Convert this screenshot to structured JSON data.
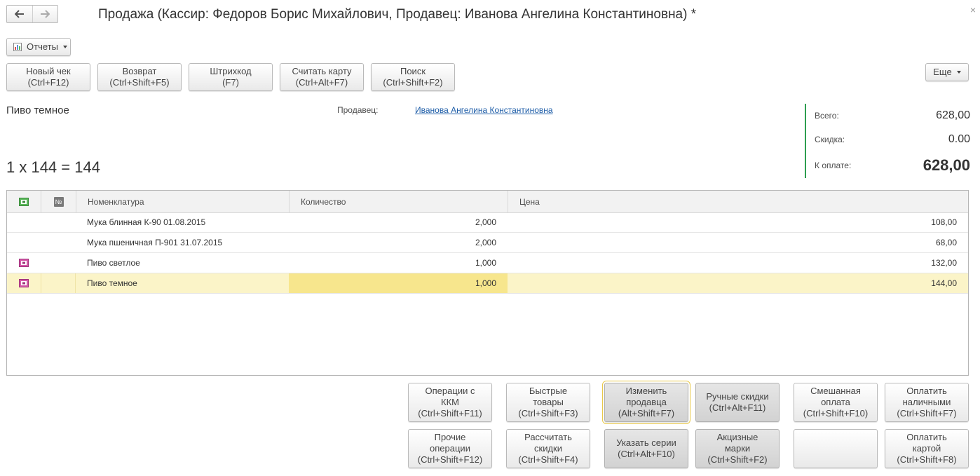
{
  "window": {
    "title": "Продажа (Кассир: Федоров Борис Михайлович, Продавец: Иванова Ангелина Константиновна) *"
  },
  "toolbar": {
    "reports_label": "Отчеты",
    "more_label": "Еще",
    "buttons": [
      {
        "line1": "Новый чек",
        "line2": "(Ctrl+F12)"
      },
      {
        "line1": "Возврат",
        "line2": "(Ctrl+Shift+F5)"
      },
      {
        "line1": "Штрихкод",
        "line2": "(F7)"
      },
      {
        "line1": "Считать карту",
        "line2": "(Ctrl+Alt+F7)"
      },
      {
        "line1": "Поиск",
        "line2": "(Ctrl+Shift+F2)"
      }
    ]
  },
  "current_item": {
    "name": "Пиво темное",
    "calc": "1 x 144 = 144"
  },
  "seller": {
    "label": "Продавец:",
    "name": "Иванова Ангелина Константиновна"
  },
  "totals": {
    "total_label": "Всего:",
    "total_value": "628,00",
    "discount_label": "Скидка:",
    "discount_value": "0.00",
    "pay_label": "К оплате:",
    "pay_value": "628,00"
  },
  "table": {
    "num_header": "№",
    "columns": [
      "Номенклатура",
      "Количество",
      "Цена"
    ],
    "rows": [
      {
        "name": "Мука блинная  К-90 01.08.2015",
        "qty": "2,000",
        "price": "108,00",
        "has_icon": false
      },
      {
        "name": "Мука пшеничная П-901  31.07.2015",
        "qty": "2,000",
        "price": "68,00",
        "has_icon": false
      },
      {
        "name": "Пиво светлое",
        "qty": "1,000",
        "price": "132,00",
        "has_icon": true
      },
      {
        "name": "Пиво темное",
        "qty": "1,000",
        "price": "144,00",
        "has_icon": true,
        "selected": true
      }
    ]
  },
  "actions": {
    "row1": [
      {
        "lines": [
          "Операции с",
          "ККМ",
          "(Ctrl+Shift+F11)"
        ]
      },
      {
        "lines": [
          "Быстрые",
          "товары",
          "(Ctrl+Shift+F3)"
        ]
      },
      {
        "lines": [
          "Изменить",
          "продавца",
          "(Alt+Shift+F7)"
        ]
      },
      {
        "lines": [
          "Ручные скидки",
          "(Ctrl+Alt+F11)"
        ]
      },
      {
        "lines": [
          "Смешанная",
          "оплата",
          "(Ctrl+Shift+F10)"
        ]
      },
      {
        "lines": [
          "Оплатить",
          "наличными",
          "(Ctrl+Shift+F7)"
        ]
      }
    ],
    "row2": [
      {
        "lines": [
          "Прочие",
          "операции",
          "(Ctrl+Shift+F12)"
        ]
      },
      {
        "lines": [
          "Рассчитать",
          "скидки",
          "(Ctrl+Shift+F4)"
        ]
      },
      {
        "lines": [
          "Указать серии",
          "(Ctrl+Alt+F10)"
        ]
      },
      {
        "lines": [
          "Акцизные",
          "марки",
          "(Ctrl+Shift+F2)"
        ]
      },
      {
        "lines": []
      },
      {
        "lines": [
          "Оплатить",
          "картой",
          "(Ctrl+Shift+F8)"
        ]
      }
    ]
  },
  "colors": {
    "accent_green": "#2e9e50",
    "selected_row": "#fbf4c8",
    "link": "#1f5ea8"
  }
}
